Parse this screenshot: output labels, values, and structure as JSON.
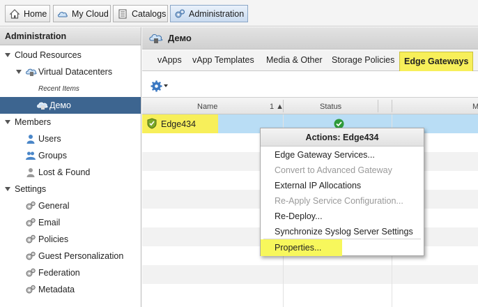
{
  "topnav": {
    "home": "Home",
    "mycloud": "My Cloud",
    "catalogs": "Catalogs",
    "administration": "Administration"
  },
  "left": {
    "title": "Administration",
    "cloud_resources": "Cloud Resources",
    "virtual_datacenters": "Virtual Datacenters",
    "recent_items": "Recent Items",
    "demo": "Демо",
    "members": "Members",
    "users": "Users",
    "groups": "Groups",
    "lost_found": "Lost & Found",
    "settings": "Settings",
    "general": "General",
    "email": "Email",
    "policies": "Policies",
    "guest_personalization": "Guest Personalization",
    "federation": "Federation",
    "metadata": "Metadata"
  },
  "main": {
    "title": "Демо",
    "tabs": [
      "vApps",
      "vApp Templates",
      "Media & Other",
      "Storage Policies",
      "Edge Gateways"
    ],
    "active_tab": "Edge Gateways",
    "columns": {
      "name": "Name",
      "sort": "1",
      "status": "Status",
      "third": "M"
    },
    "rows": [
      {
        "name": "Edge434",
        "status": "ok"
      }
    ]
  },
  "context_menu": {
    "title": "Actions: Edge434",
    "items": [
      {
        "label": "Edge Gateway Services...",
        "enabled": true
      },
      {
        "label": "Convert to Advanced Gateway",
        "enabled": false
      },
      {
        "label": "External IP Allocations",
        "enabled": true
      },
      {
        "label": "Re-Apply Service Configuration...",
        "enabled": false
      },
      {
        "label": "Re-Deploy...",
        "enabled": true
      },
      {
        "label": "Synchronize Syslog Server Settings",
        "enabled": true
      },
      {
        "label": "Properties...",
        "enabled": true
      }
    ]
  },
  "colors": {
    "highlight_yellow": "#f7ef5a",
    "selected_row": "#b9ddf5",
    "tree_selected": "#3d6590",
    "status_ok": "#2e9a3a"
  },
  "icons": {
    "home": "home-icon",
    "mycloud": "cloud-icon",
    "catalogs": "catalog-icon",
    "administration": "gears-icon",
    "settings_gear": "gear-icon",
    "user": "user-icon",
    "group": "group-icon",
    "datacenter": "datacenter-icon",
    "edge": "shield-icon",
    "status": "check-circle-icon"
  }
}
